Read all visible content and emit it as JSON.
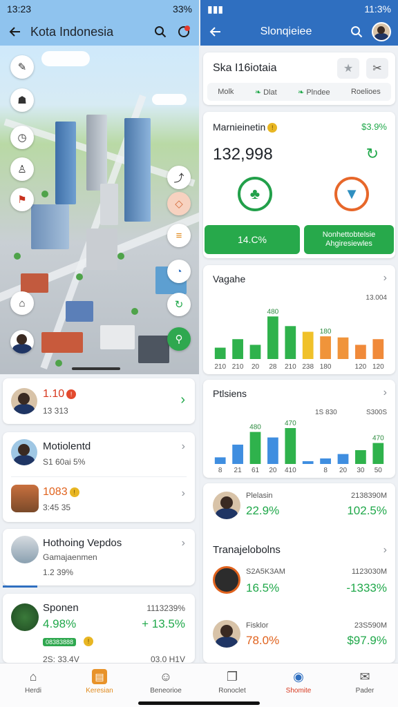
{
  "left": {
    "status": {
      "time": "13:23",
      "battery": "33%"
    },
    "appbar": {
      "title": "Kota Indonesia"
    },
    "cards": [
      {
        "value": "1.10",
        "sub": "13 313"
      },
      {
        "title": "Motiolentd",
        "sub": "S1 60ai 5%"
      },
      {
        "value": "1083",
        "sub": "3:45 35"
      },
      {
        "title": "Hothoing Vepdos",
        "sub": "Gamajaenmen",
        "sub2": "1.2 39%"
      },
      {
        "title": "Sponen",
        "right": "1113239%",
        "left_val": "4.98%",
        "right_val": "+ 13.5%",
        "badge": "08383888",
        "footer": "2S: 33.4V",
        "footer_right": "03.0 H1V"
      }
    ]
  },
  "right": {
    "status": {
      "time": "11:3%"
    },
    "appbar": {
      "title": "Slonqieiee"
    },
    "header": {
      "title": "Ska I16iotaia",
      "tabs": [
        "Molk",
        "Dlat",
        "Plndee",
        "Roelioes"
      ]
    },
    "market": {
      "title": "Marnieinetin",
      "change": "$3.9%",
      "value": "132,998",
      "btn_left": "14.C%",
      "btn_right": "Nonhettobtelsie Ahgiresiewles"
    },
    "chart1": {
      "title": "Vagahe",
      "right_label": "13.004"
    },
    "chart2": {
      "title": "Ptlsiens",
      "mid_label": "1S 830",
      "right_label": "S300S"
    },
    "people": {
      "name": "Plelasin",
      "pct": "22.9%",
      "right_top": "2138390M",
      "right_val": "102.5%"
    },
    "transactions": {
      "title": "Tranajelobolns",
      "items": [
        {
          "label": "S2A5K3AM",
          "pct": "16.5%",
          "right_top": "1123030M",
          "right_val": "-1333%"
        },
        {
          "label": "Fisklor",
          "pct": "78.0%",
          "right_top": "23S590M",
          "right_val": "$97.9%"
        }
      ]
    }
  },
  "bottomnav": [
    {
      "label": "Herdi",
      "icon": "home-icon"
    },
    {
      "label": "Keresian",
      "icon": "wallet-icon"
    },
    {
      "label": "Beneorioe",
      "icon": "people-icon"
    },
    {
      "label": "Ronoclet",
      "icon": "pages-icon"
    },
    {
      "label": "Shomite",
      "icon": "globe-icon"
    },
    {
      "label": "Pader",
      "icon": "mail-icon"
    }
  ],
  "chart_data": [
    {
      "type": "bar",
      "title": "Vagahe",
      "categories": [
        "210",
        "210",
        "20",
        "28",
        "210",
        "238",
        "180",
        "",
        "120",
        "120"
      ],
      "values": [
        20,
        35,
        25,
        75,
        58,
        48,
        40,
        38,
        25,
        35
      ],
      "data_labels": {
        "3": "480",
        "6": "180"
      },
      "colors": [
        "#2fb24c",
        "#2fb24c",
        "#2fb24c",
        "#2fb24c",
        "#2fb24c",
        "#f0c12a",
        "#f0943a",
        "#f0943a",
        "#f08a3a",
        "#f08a3a"
      ],
      "ylim": [
        0,
        90
      ]
    },
    {
      "type": "bar",
      "title": "Ptlsiens",
      "categories": [
        "8",
        "21",
        "61",
        "20",
        "410",
        "",
        "8",
        "20",
        "30",
        "50"
      ],
      "values": [
        12,
        35,
        58,
        48,
        65,
        5,
        10,
        18,
        25,
        38
      ],
      "data_labels": {
        "2": "480",
        "4": "470",
        "9": "470"
      },
      "colors": [
        "#3f8ee0",
        "#3f8ee0",
        "#2fb24c",
        "#3f8ee0",
        "#2fb24c",
        "#3f8ee0",
        "#3f8ee0",
        "#3f8ee0",
        "#2fb24c",
        "#2fb24c"
      ],
      "ylim": [
        0,
        80
      ]
    }
  ]
}
